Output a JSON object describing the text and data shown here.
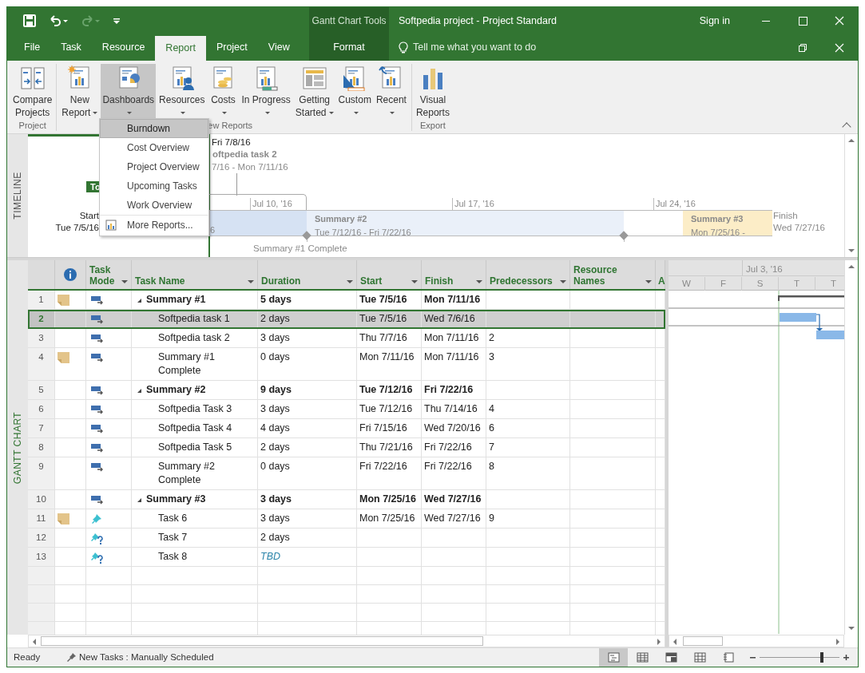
{
  "window": {
    "title": "Softpedia project - Project Standard",
    "context_title": "Gantt Chart Tools",
    "sign_in": "Sign in"
  },
  "tabs": [
    {
      "label": "File",
      "selected": false
    },
    {
      "label": "Task",
      "selected": false
    },
    {
      "label": "Resource",
      "selected": false
    },
    {
      "label": "Report",
      "selected": true
    },
    {
      "label": "Project",
      "selected": false
    },
    {
      "label": "View",
      "selected": false
    },
    {
      "label": "Format",
      "selected": false,
      "kind": "contextual"
    }
  ],
  "tell_me": "Tell me what you want to do",
  "ribbon_groups": [
    {
      "label": "Project",
      "buttons": [
        {
          "lines": [
            "Compare",
            "Projects"
          ],
          "dropdown": false,
          "pressed": false
        }
      ]
    },
    {
      "label": "ew Reports",
      "buttons": [
        {
          "lines": [
            "New",
            "Report"
          ],
          "dropdown": true,
          "pressed": false
        },
        {
          "lines": [
            "Dashboards"
          ],
          "dropdown": true,
          "pressed": true
        },
        {
          "lines": [
            "Resources"
          ],
          "dropdown": true,
          "pressed": false
        },
        {
          "lines": [
            "Costs"
          ],
          "dropdown": true,
          "pressed": false
        },
        {
          "lines": [
            "In Progress"
          ],
          "dropdown": true,
          "pressed": false
        },
        {
          "lines": [
            "Getting",
            "Started"
          ],
          "dropdown": true,
          "pressed": false
        },
        {
          "lines": [
            "Custom"
          ],
          "dropdown": true,
          "pressed": false
        },
        {
          "lines": [
            "Recent"
          ],
          "dropdown": true,
          "pressed": false
        }
      ]
    },
    {
      "label": "Export",
      "buttons": [
        {
          "lines": [
            "Visual",
            "Reports"
          ],
          "dropdown": false,
          "pressed": false
        }
      ]
    }
  ],
  "dashboards_menu": [
    {
      "label": "Burndown",
      "selected": true,
      "kind": "report"
    },
    {
      "label": "Cost Overview",
      "selected": false,
      "kind": "report"
    },
    {
      "label": "Project Overview",
      "selected": false,
      "kind": "report"
    },
    {
      "label": "Upcoming Tasks",
      "selected": false,
      "kind": "report"
    },
    {
      "label": "Work Overview",
      "selected": false,
      "kind": "report"
    },
    {
      "label": "More Reports...",
      "selected": false,
      "kind": "command"
    }
  ],
  "side_labels": {
    "timeline": "TIMELINE",
    "gantt": "GANTT CHART"
  },
  "timeline": {
    "today_marker": "To",
    "start_label": "Start",
    "start_date": "Tue 7/5/16",
    "callout": {
      "date": "Fri 7/8/16",
      "name": "oftpedia task 2",
      "range": "7/16 - Mon 7/11/16"
    },
    "ticks": [
      "Jul 10, '16",
      "Jul 17, '16",
      "Jul 24, '16"
    ],
    "bars": [
      {
        "dates": "6",
        "color": "#d6e2f3"
      },
      {
        "name": "Summary #2",
        "dates": "Tue 7/12/16 - Fri 7/22/16",
        "color": "#eaf0f9"
      },
      {
        "name": "Summary #3",
        "dates": "Mon 7/25/16 -",
        "color": "#fcedc7"
      }
    ],
    "milestone": "Summary #1 Complete",
    "finish_label": "Finish",
    "finish_date": "Wed 7/27/16"
  },
  "table": {
    "columns": [
      "Task Mode",
      "Task Name",
      "Duration",
      "Start",
      "Finish",
      "Predecessors",
      "Resource Names",
      "A"
    ],
    "rows": [
      {
        "id": "1",
        "note": true,
        "kind": "auto",
        "name": "Summary #1",
        "duration": "5 days",
        "start": "Tue 7/5/16",
        "finish": "Mon 7/11/16",
        "selected": false,
        "unset": false,
        "expanded": true,
        "children": [
          {
            "id": "2",
            "note": false,
            "kind": "auto",
            "name": "Softpedia task 1",
            "duration": "2 days",
            "start": "Tue 7/5/16",
            "finish": "Wed 7/6/16",
            "selected": true,
            "unset": false
          },
          {
            "id": "3",
            "note": false,
            "kind": "auto",
            "name": "Softpedia task 2",
            "duration": "3 days",
            "start": "Thu 7/7/16",
            "finish": "Mon 7/11/16",
            "predecessors": "2",
            "selected": false,
            "unset": false
          },
          {
            "id": "4",
            "note": true,
            "kind": "auto",
            "name": "Summary #1 Complete",
            "duration": "0 days",
            "start": "Mon 7/11/16",
            "finish": "Mon 7/11/16",
            "predecessors": "3",
            "selected": false,
            "unset": false
          }
        ]
      },
      {
        "id": "5",
        "note": false,
        "kind": "auto",
        "name": "Summary #2",
        "duration": "9 days",
        "start": "Tue 7/12/16",
        "finish": "Fri 7/22/16",
        "selected": false,
        "unset": false,
        "expanded": true,
        "children": [
          {
            "id": "6",
            "note": false,
            "kind": "auto",
            "name": "Softpedia Task 3",
            "duration": "3 days",
            "start": "Tue 7/12/16",
            "finish": "Thu 7/14/16",
            "predecessors": "4",
            "selected": false,
            "unset": false
          },
          {
            "id": "7",
            "note": false,
            "kind": "auto",
            "name": "Softpedia Task 4",
            "duration": "4 days",
            "start": "Fri 7/15/16",
            "finish": "Wed 7/20/16",
            "predecessors": "6",
            "selected": false,
            "unset": false
          },
          {
            "id": "8",
            "note": false,
            "kind": "auto",
            "name": "Softpedia Task 5",
            "duration": "2 days",
            "start": "Thu 7/21/16",
            "finish": "Fri 7/22/16",
            "predecessors": "7",
            "selected": false,
            "unset": false
          },
          {
            "id": "9",
            "note": false,
            "kind": "auto",
            "name": "Summary #2 Complete",
            "duration": "0 days",
            "start": "Fri 7/22/16",
            "finish": "Fri 7/22/16",
            "predecessors": "8",
            "selected": false,
            "unset": false
          }
        ]
      },
      {
        "id": "10",
        "note": false,
        "kind": "auto",
        "name": "Summary #3",
        "duration": "3 days",
        "start": "Mon 7/25/16",
        "finish": "Wed 7/27/16",
        "selected": false,
        "unset": false,
        "expanded": true,
        "children": [
          {
            "id": "11",
            "note": true,
            "kind": "manual",
            "name": "Task 6",
            "duration": "3 days",
            "start": "Mon 7/25/16",
            "finish": "Wed 7/27/16",
            "predecessors": "9",
            "selected": false,
            "unset": false
          },
          {
            "id": "12",
            "note": false,
            "kind": "unscheduled",
            "name": "Task 7",
            "duration": "2 days",
            "selected": false,
            "unset": false
          },
          {
            "id": "13",
            "note": false,
            "kind": "unscheduled",
            "name": "Task 8",
            "duration": "TBD",
            "selected": false,
            "unset": true
          }
        ]
      }
    ]
  },
  "gantt": {
    "week": "Jul 3, '16",
    "days": [
      "W",
      "F",
      "S",
      "T",
      "T"
    ]
  },
  "status_bar": {
    "text": "Ready",
    "new_tasks": "New Tasks : Manually Scheduled",
    "views": [
      {
        "selected": true
      },
      {
        "selected": false
      },
      {
        "selected": false
      },
      {
        "selected": false
      },
      {
        "selected": false
      }
    ],
    "zoom": {
      "level": 0.78
    }
  }
}
